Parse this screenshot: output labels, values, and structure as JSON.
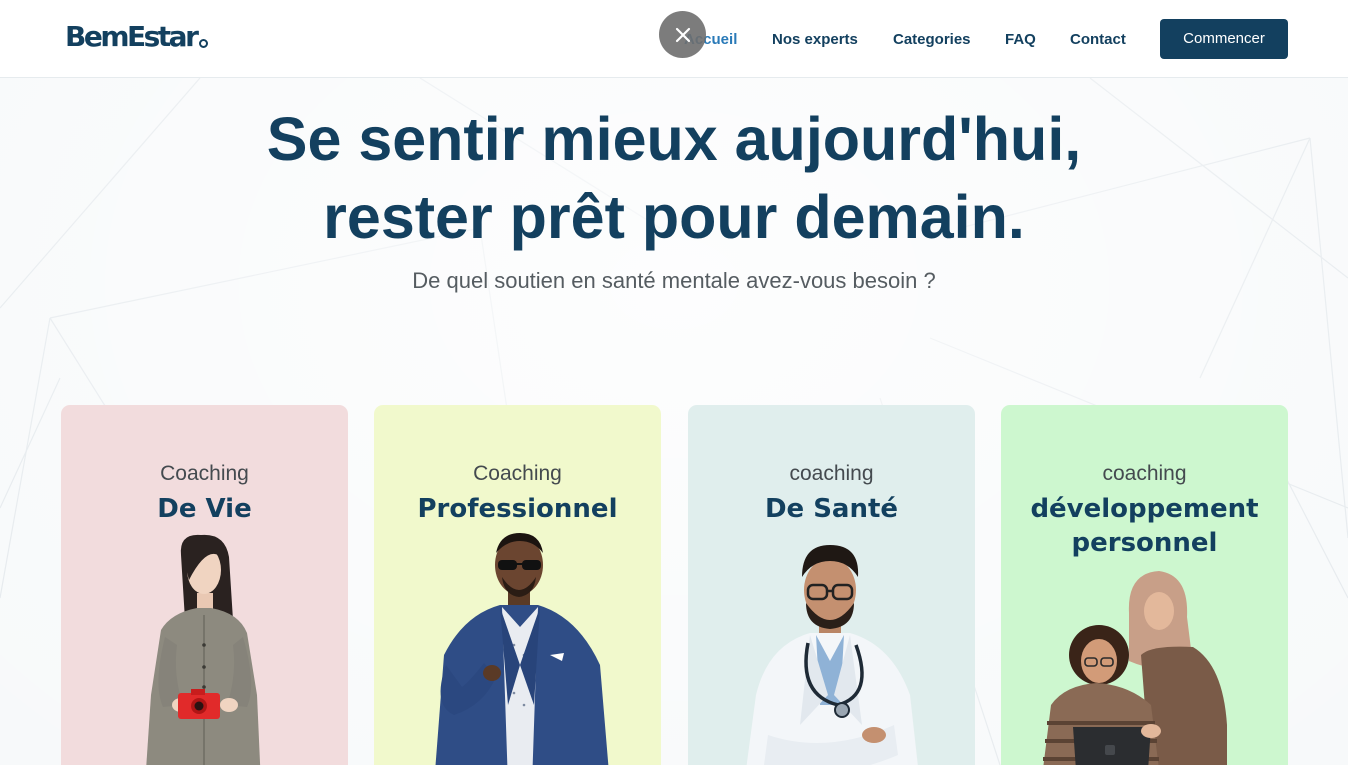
{
  "header": {
    "logo_text": "BemEstar",
    "nav": [
      {
        "label": "Accueil",
        "active": true
      },
      {
        "label": "Nos experts",
        "active": false
      },
      {
        "label": "Categories",
        "active": false
      },
      {
        "label": "FAQ",
        "active": false
      },
      {
        "label": "Contact",
        "active": false
      }
    ],
    "cta_label": "Commencer",
    "close_symbol": "×"
  },
  "hero": {
    "title_line1": "Se sentir mieux aujourd'hui,",
    "title_line2": "rester prêt pour demain.",
    "subtitle": "De quel soutien en santé mentale avez-vous besoin ?"
  },
  "cards": [
    {
      "kicker": "Coaching",
      "title": "De Vie",
      "image": "woman-with-red-camera",
      "color": "#f2dcdd"
    },
    {
      "kicker": "Coaching",
      "title": "Professionnel",
      "image": "man-in-blue-suit-sunglasses",
      "color": "#f1f9cc"
    },
    {
      "kicker": "coaching",
      "title": "De Santé",
      "image": "doctor-with-stethoscope",
      "color": "#e0eeed"
    },
    {
      "kicker": "coaching",
      "title_line1": "développement",
      "title_line2": "personnel",
      "image": "two-women-with-laptop",
      "color": "#cdf7cf"
    }
  ],
  "colors": {
    "brand_navy": "#13405f",
    "nav_active": "#2a7ab8",
    "subtitle_gray": "#555c61"
  }
}
